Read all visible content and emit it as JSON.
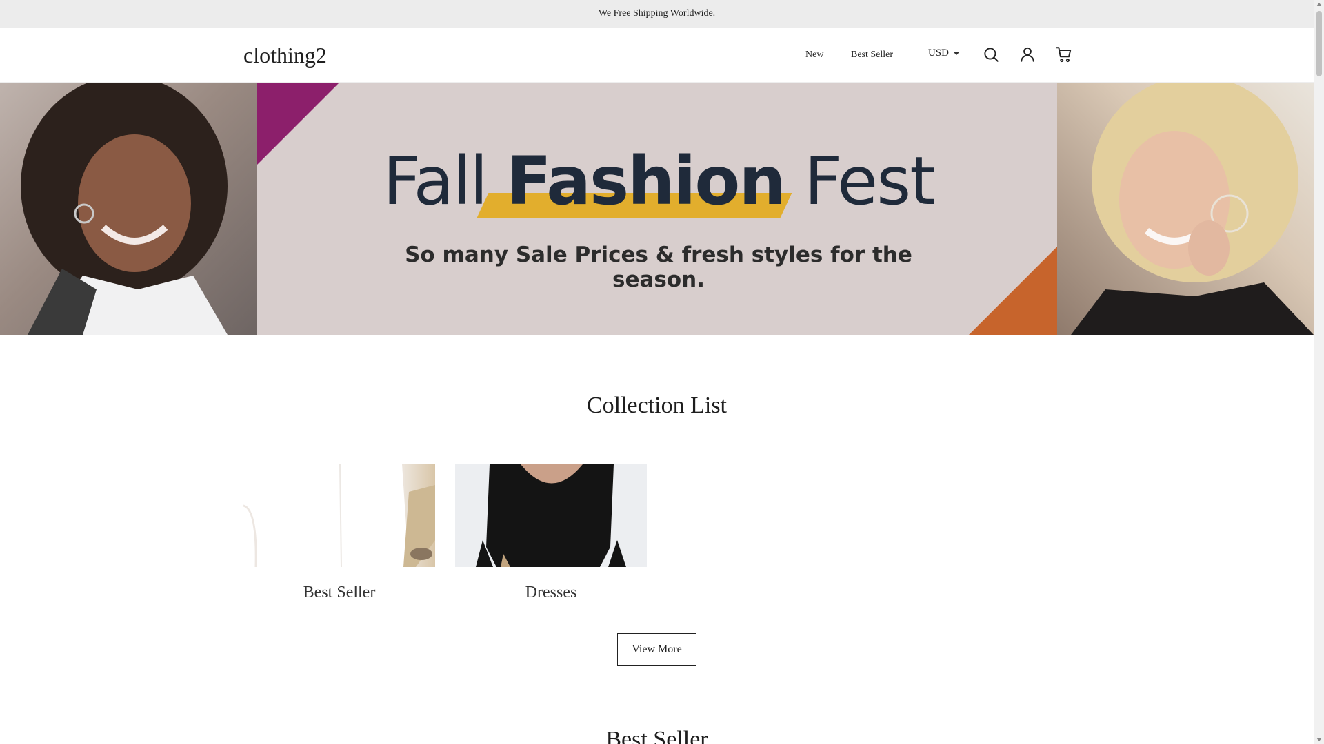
{
  "announcement": "We Free Shipping Worldwide.",
  "header": {
    "logo": "clothing2",
    "nav": [
      {
        "label": "New"
      },
      {
        "label": "Best Seller"
      }
    ],
    "currency": "USD",
    "icons": [
      "search-icon",
      "account-icon",
      "cart-icon"
    ]
  },
  "banner": {
    "title_start": "Fall ",
    "title_bold": "Fashion",
    "title_end": " Fest",
    "subtitle": "So many Sale Prices & fresh styles for the season.",
    "colors": {
      "background": "#d8cecd",
      "purple": "#8c1f6b",
      "orange": "#c7642c",
      "yellow": "#e2ae2d",
      "text": "#1f2a3a"
    }
  },
  "collection": {
    "title": "Collection List",
    "items": [
      {
        "label": "Best Seller"
      },
      {
        "label": "Dresses"
      }
    ],
    "view_more": "View More"
  },
  "best_seller": {
    "title": "Best Seller"
  }
}
